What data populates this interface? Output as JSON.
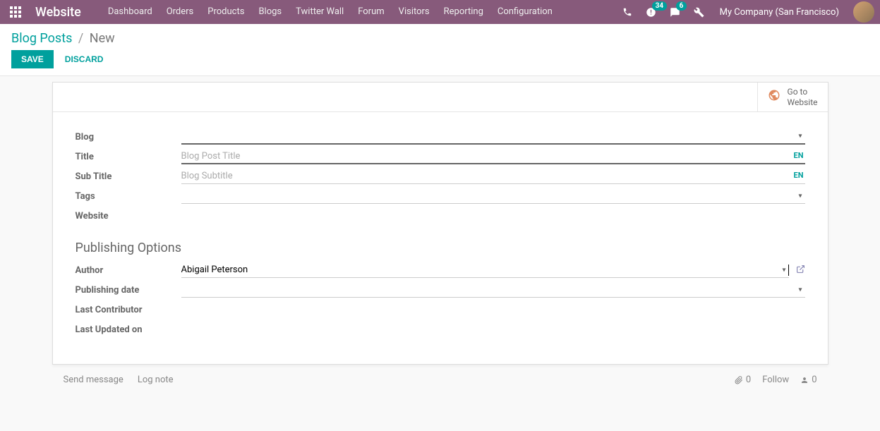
{
  "navbar": {
    "brand": "Website",
    "menu": [
      "Dashboard",
      "Orders",
      "Products",
      "Blogs",
      "Twitter Wall",
      "Forum",
      "Visitors",
      "Reporting",
      "Configuration"
    ],
    "badges": {
      "activities": "34",
      "messages": "6"
    },
    "company": "My Company (San Francisco)"
  },
  "breadcrumb": {
    "root": "Blog Posts",
    "current": "New"
  },
  "actions": {
    "save": "SAVE",
    "discard": "DISCARD"
  },
  "stat_button": {
    "line1": "Go to",
    "line2": "Website"
  },
  "form": {
    "labels": {
      "blog": "Blog",
      "title": "Title",
      "subtitle": "Sub Title",
      "tags": "Tags",
      "website": "Website"
    },
    "placeholders": {
      "title": "Blog Post Title",
      "subtitle": "Blog Subtitle"
    },
    "lang": "EN",
    "section_publishing": "Publishing Options",
    "labels2": {
      "author": "Author",
      "pubdate": "Publishing date",
      "lastcontrib": "Last Contributor",
      "lastupdated": "Last Updated on"
    },
    "values": {
      "author": "Abigail Peterson"
    }
  },
  "chatter": {
    "send": "Send message",
    "log": "Log note",
    "attach": "0",
    "follow": "Follow",
    "followers": "0"
  }
}
